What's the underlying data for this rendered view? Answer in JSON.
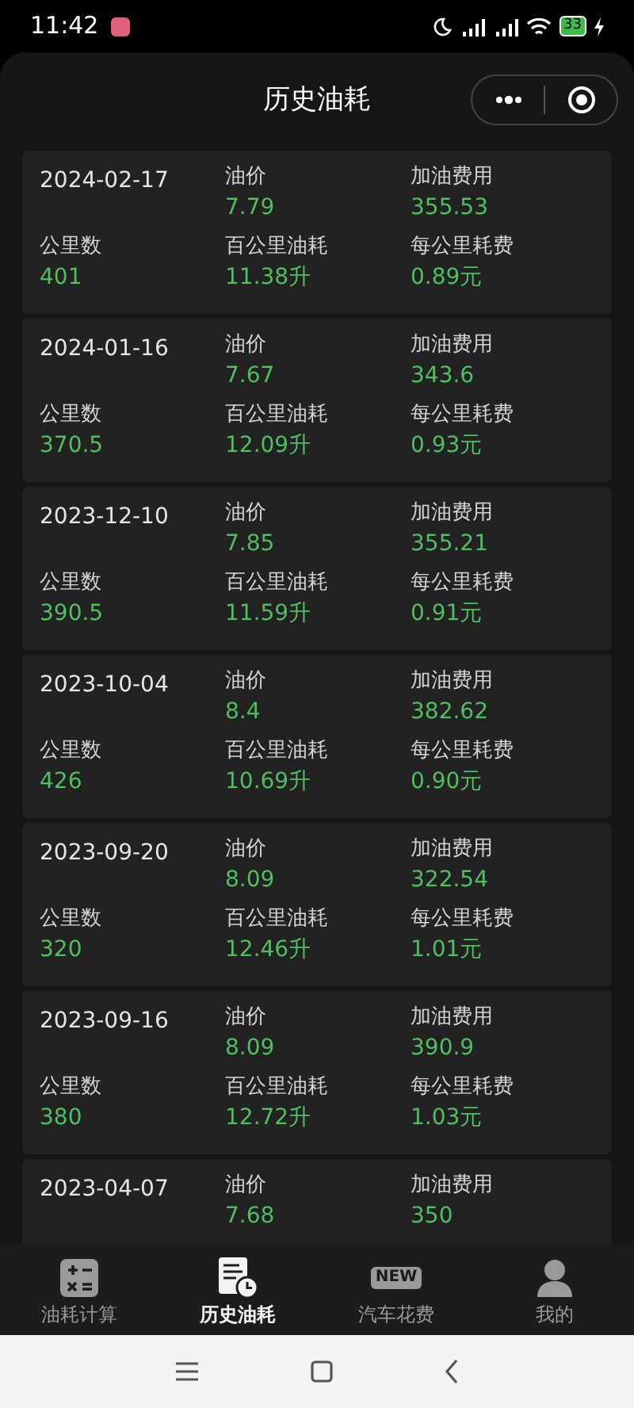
{
  "status_bar": {
    "time": "11:42",
    "battery": "33"
  },
  "header": {
    "title": "历史油耗"
  },
  "records": [
    {
      "date": "2024-02-17",
      "price_label": "油价",
      "price": "7.79",
      "cost_label": "加油费用",
      "cost": "355.53",
      "km_label": "公里数",
      "km": "401",
      "per100_label": "百公里油耗",
      "per100": "11.38升",
      "perkm_label": "每公里耗费",
      "perkm": "0.89元"
    },
    {
      "date": "2024-01-16",
      "price_label": "油价",
      "price": "7.67",
      "cost_label": "加油费用",
      "cost": "343.6",
      "km_label": "公里数",
      "km": "370.5",
      "per100_label": "百公里油耗",
      "per100": "12.09升",
      "perkm_label": "每公里耗费",
      "perkm": "0.93元"
    },
    {
      "date": "2023-12-10",
      "price_label": "油价",
      "price": "7.85",
      "cost_label": "加油费用",
      "cost": "355.21",
      "km_label": "公里数",
      "km": "390.5",
      "per100_label": "百公里油耗",
      "per100": "11.59升",
      "perkm_label": "每公里耗费",
      "perkm": "0.91元"
    },
    {
      "date": "2023-10-04",
      "price_label": "油价",
      "price": "8.4",
      "cost_label": "加油费用",
      "cost": "382.62",
      "km_label": "公里数",
      "km": "426",
      "per100_label": "百公里油耗",
      "per100": "10.69升",
      "perkm_label": "每公里耗费",
      "perkm": "0.90元"
    },
    {
      "date": "2023-09-20",
      "price_label": "油价",
      "price": "8.09",
      "cost_label": "加油费用",
      "cost": "322.54",
      "km_label": "公里数",
      "km": "320",
      "per100_label": "百公里油耗",
      "per100": "12.46升",
      "perkm_label": "每公里耗费",
      "perkm": "1.01元"
    },
    {
      "date": "2023-09-16",
      "price_label": "油价",
      "price": "8.09",
      "cost_label": "加油费用",
      "cost": "390.9",
      "km_label": "公里数",
      "km": "380",
      "per100_label": "百公里油耗",
      "per100": "12.72升",
      "perkm_label": "每公里耗费",
      "perkm": "1.03元"
    },
    {
      "date": "2023-04-07",
      "price_label": "油价",
      "price": "7.68",
      "cost_label": "加油费用",
      "cost": "350"
    }
  ],
  "tab_bar": [
    {
      "label": "油耗计算",
      "kind": "calculator",
      "selected": false
    },
    {
      "label": "历史油耗",
      "kind": "history",
      "selected": true
    },
    {
      "label": "汽车花费",
      "kind": "new",
      "badge": "NEW",
      "selected": false
    },
    {
      "label": "我的",
      "kind": "profile",
      "selected": false
    }
  ]
}
